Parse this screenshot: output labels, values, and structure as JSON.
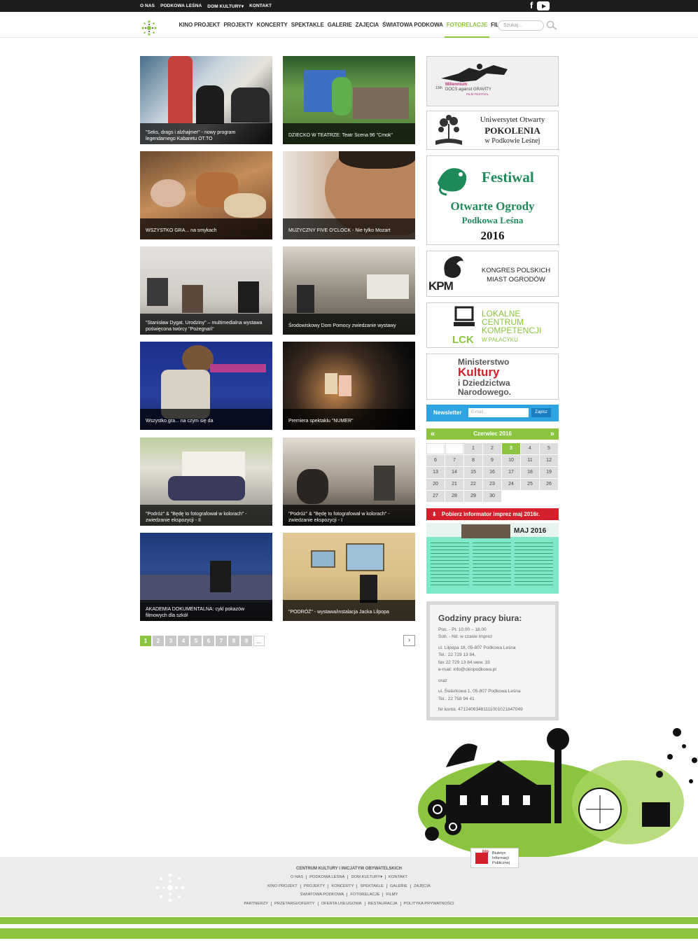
{
  "topnav": {
    "items": [
      "O NAS",
      "PODKOWA LEŚNA",
      "DOM KULTURY▾",
      "KONTAKT"
    ],
    "social": [
      "facebook-icon",
      "youtube-icon"
    ]
  },
  "mainnav": {
    "items": [
      "KINO PROJEKT",
      "PROJEKTY",
      "KONCERTY",
      "SPEKTAKLE",
      "GALERIE",
      "ZAJĘCIA",
      "ŚWIATOWA PODKOWA",
      "FOTORELACJE",
      "FILMY"
    ],
    "active": "FOTORELACJE",
    "search_placeholder": "Szukaj..."
  },
  "gallery": [
    {
      "caption": "\"Seks, drags i alzhajmer\" - nowy program legendarnego Kabaretu OT.TO"
    },
    {
      "caption": "DZIECKO W TEATRZE: Teatr Scena 96 \"Cmok\""
    },
    {
      "caption": "WSZYSTKO GRA... na smykach"
    },
    {
      "caption": "MUZYCZNY FIVE O'CLOCK - Nie tylko Mozart"
    },
    {
      "caption": "\"Stanisław Dygat. Urodziny\" – multimedialna wystawa poświęcona twórcy \"Pożegnań\""
    },
    {
      "caption": "Środowiskowy Dom Pomocy zwiedzanie wystawy"
    },
    {
      "caption": "Wszystko gra... na czym się da"
    },
    {
      "caption": "Premiera spektaklu \"NUMER\""
    },
    {
      "caption": "\"Podróż\" & \"Będę to fotografował w kolorach\" - zwiedzanie ekspozycji - II"
    },
    {
      "caption": "\"Podróż\" & \"Będę to fotografował w kolorach\" - zwiedzanie ekspozycji - I"
    },
    {
      "caption": "AKADEMIA DOKUMENTALNA: cykl pokazów filmowych dla szkół"
    },
    {
      "caption": "\"PODRÓŻ\" - wystawa/instalacja Jacka Lilpopa"
    }
  ],
  "pager": {
    "pages": [
      "1",
      "2",
      "3",
      "4",
      "5",
      "6",
      "7",
      "8",
      "9",
      "..."
    ],
    "current": "1",
    "next": "›"
  },
  "banners": {
    "b1_line1": "13th",
    "b1_line2": "Millennium",
    "b1_line3": "DOCS against GRAVITY",
    "b1_line4": "FILM FESTIVAL",
    "b2_line1": "Uniwersytet Otwarty",
    "b2_line2": "POKOLENIA",
    "b2_line3": "w Podkowie Leśnej",
    "b3_line1": "Festiwal",
    "b3_line2": "Otwarte Ogrody",
    "b3_line3": "Podkowa Leśna",
    "b3_line4": "2016",
    "b4_logo": "KPM",
    "b4_line1": "KONGRES POLSKICH",
    "b4_line2": "MIAST OGRODÓW",
    "b5_line1": "LOKALNE",
    "b5_line2": "CENTRUM",
    "b5_line3": "KOMPETENCJI",
    "b5_line4": "W PAŁACYKU",
    "b5_logo": "LCK",
    "b6_line1": "Ministerstwo",
    "b6_line2": "Kultury",
    "b6_line3": "i Dziedzictwa",
    "b6_line4": "Narodowego."
  },
  "newsletter": {
    "label": "Newsletter",
    "placeholder": "E-mail...",
    "button": "Zapisz"
  },
  "calendar": {
    "title": "Czerwiec 2016",
    "prev": "«",
    "next": "»",
    "cells": [
      "",
      "",
      "1",
      "2",
      "3",
      "4",
      "5",
      "6",
      "7",
      "8",
      "9",
      "10",
      "11",
      "12",
      "13",
      "14",
      "15",
      "16",
      "17",
      "18",
      "19",
      "20",
      "21",
      "22",
      "23",
      "24",
      "25",
      "26",
      "27",
      "28",
      "29",
      "30"
    ],
    "today": "3"
  },
  "download": {
    "label": "Pobierz informator imprez maj 2016r.",
    "poster_title": "MAJ 2016"
  },
  "office": {
    "title": "Godziny pracy biura:",
    "hours1": "Pon. - Pt.  10.00 – 18.00",
    "hours2": "Sob. - Nd.  w czasie imprez",
    "addr1": "ul. Lilpopa 18, 05-807 Podkowa Leśna",
    "tel1": "Tel.: 22 729 13 84,",
    "fax": "fax 22 729 13 84 wew. 33",
    "email": "e-mail: info@ckiopodkowa.pl",
    "oraz": "oraz",
    "addr2": "ul. Świerkowa 1, 05-807 Podkowa Leśna",
    "tel2": "Tel.: 22 758 94 41",
    "account": "Nr konta: 47124063481111001021847049"
  },
  "footer": {
    "title": "CENTRUM KULTURY I INICJATYW OBYWATELSKICH",
    "bip_line1": "Biuletyn",
    "bip_line2": "Informacji",
    "bip_line3": "Publicznej",
    "bip_logo": "bip",
    "row1": [
      "O NAS",
      "PODKOWA LEŚNA",
      "DOM KULTURY▾",
      "KONTAKT"
    ],
    "row2": [
      "KINO PROJEKT",
      "PROJEKTY",
      "KONCERTY",
      "SPEKTAKLE",
      "GALERIE",
      "ZAJĘCIA"
    ],
    "row3": [
      "ŚWIATOWA PODKOWA",
      "FOTORELACJE",
      "FILMY"
    ],
    "row4": [
      "PARTNERZY",
      "PRZETARGI/OFERTY",
      "OFERTA USŁUGOWA",
      "RESTAURACJA",
      "POLITYKA PRYWATNOŚCI"
    ]
  },
  "colors": {
    "accent": "#8bc53f",
    "topbar": "#1d1d1d",
    "newsletter": "#2ea4e0",
    "download": "#d3202a"
  }
}
